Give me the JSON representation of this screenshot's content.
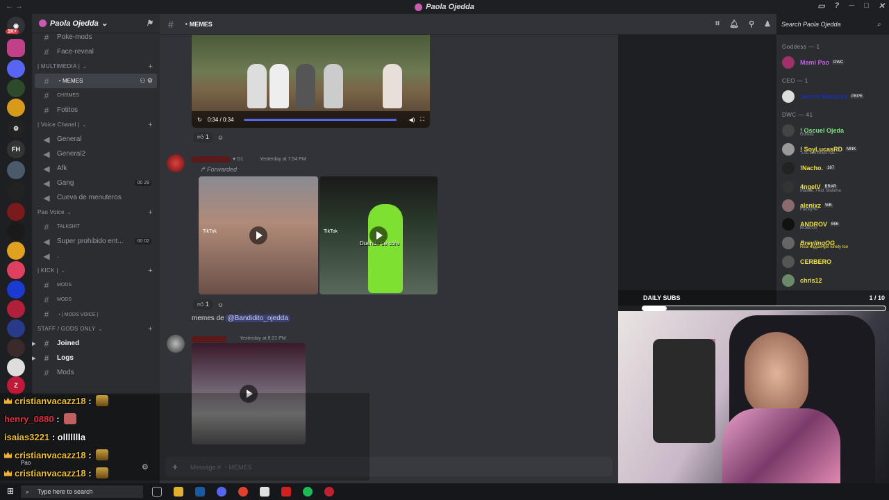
{
  "window": {
    "title": "Paola Ojedda"
  },
  "server": {
    "name": "Paola Ojedda"
  },
  "server_rail": {
    "badge": "1K+"
  },
  "channels": {
    "top": [
      {
        "name": "Poke-mods"
      },
      {
        "name": "Face-reveal"
      }
    ],
    "cat_multimedia": "| MULTIMEDIA |",
    "multimedia": [
      {
        "name": "・MEMES"
      },
      {
        "name": "CHISMES"
      },
      {
        "name": "Fotitos"
      }
    ],
    "cat_voice": "| Voice Chanel |",
    "voice": [
      {
        "name": "General"
      },
      {
        "name": "General2"
      },
      {
        "name": "Afk"
      },
      {
        "name": "Gang",
        "c1": "00",
        "c2": "29"
      },
      {
        "name": "Cueva de menuteros"
      }
    ],
    "cat_pao": "Pao Voice",
    "pao": [
      {
        "name": "TALKSHIT"
      },
      {
        "name": "Super prohibido ent...",
        "c1": "00",
        "c2": "02"
      },
      {
        "name": "."
      }
    ],
    "cat_kick": "| KICK |",
    "kick": [
      {
        "name": "MODS"
      },
      {
        "name": "MODS"
      },
      {
        "name": "・| MODS VOICE |"
      }
    ],
    "cat_staff": "STAFF / GODS ONLY",
    "staff": [
      {
        "name": "Joined"
      },
      {
        "name": "Logs"
      },
      {
        "name": "Mods"
      }
    ]
  },
  "chat_header": {
    "channel": "・MEMES"
  },
  "search": {
    "placeholder": "Search Paola Ojedda"
  },
  "messages": {
    "video_time": "0:34 / 0:34",
    "reaction_count_1": "1",
    "msg2_time": "Yesterday at 7:54 PM",
    "msg2_role": "D1",
    "forwarded": "Forwarded",
    "tiktok": "TikTok",
    "overlay_caption": "Duende de core",
    "reaction_count_2": "1",
    "memes_text": "memes de",
    "mention": "@Bandidito_ojedda",
    "msg3_time": "Yesterday at 8:21 PM"
  },
  "composer": {
    "placeholder": "Message # ・MEMES"
  },
  "members": {
    "cat_goddess": "Goddess — 1",
    "goddess": [
      {
        "name": "Mami Pao",
        "tag": "DWC",
        "color": "#c060e0"
      }
    ],
    "cat_ceo": "CEO — 1",
    "ceo": [
      {
        "name": "Jeremi Marquez",
        "tag": "PEPE",
        "color": "#1a2fb0"
      }
    ],
    "cat_dwc": "DWC — 41",
    "dwc": [
      {
        "name": "! Oscuel Ojeda",
        "status": "Gordas",
        "color": "#7ee07e"
      },
      {
        "name": "! SoyLucasRD",
        "tag": "MNK",
        "status": "\"Los demonios nac...",
        "color": "#f0e040"
      },
      {
        "name": "!Nacho.",
        "tag": "187",
        "color": "#f0e040"
      },
      {
        "name": "4ngelV",
        "tag": "BRAR",
        "status": "Maisak, Feid, Maluma",
        "color": "#f0e040"
      },
      {
        "name": "alenixz",
        "tag": "WB",
        "status": "FamilyRP",
        "color": "#f0e040"
      },
      {
        "name": "ANDROV",
        "tag": "666",
        "status": "ROBLOX",
        "color": "#f0e040"
      },
      {
        "name": "BreylingOG",
        "status": "Real niggas get lonely too",
        "color": "#f0e040"
      },
      {
        "name": "CERBERO",
        "color": "#f0e040"
      },
      {
        "name": "chris12",
        "color": "#f0e040"
      }
    ]
  },
  "stream_chat": [
    {
      "user": "cristianvacazz18",
      "text": ":"
    },
    {
      "user": "henry_0880",
      "text": ":"
    },
    {
      "user": "isaias3221",
      "text": ": ollllllla"
    },
    {
      "user": "cristianvacazz18",
      "text": ":"
    },
    {
      "user": "cristianvacazz18",
      "text": ":"
    }
  ],
  "user_panel": {
    "name": "Pao"
  },
  "daily_subs": {
    "label": "DAILY SUBS",
    "count": "1 / 10",
    "progress": 0.1
  },
  "taskbar": {
    "search": "Type here to search"
  }
}
